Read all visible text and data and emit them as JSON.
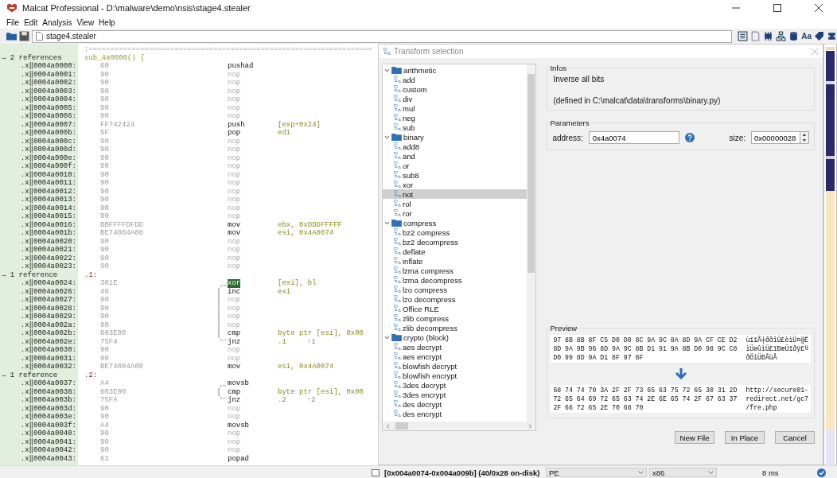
{
  "window": {
    "title": "Malcat Professional - D:\\malware\\demo\\nsis\\stage4.stealer"
  },
  "menu": [
    {
      "label": "File"
    },
    {
      "label": "Edit"
    },
    {
      "label": "Analysis"
    },
    {
      "label": "View"
    },
    {
      "label": "Help"
    }
  ],
  "toolbar": {
    "path": "stage4.stealer",
    "font_button": "Aa"
  },
  "disassembly": {
    "separator": ";==================================================================",
    "rows": [
      {
        "kind": "ref",
        "ref": "→ 2 references",
        "label": "sub_4a0000() {"
      },
      {
        "kind": "ins",
        "addr": ".x‖0004a0000:",
        "bytes": "60",
        "mnem": "pushad",
        "dim": false,
        "highlighted": false
      },
      {
        "kind": "ins",
        "addr": ".x‖0004a0001:",
        "bytes": "90",
        "mnem": "nop",
        "dim": true,
        "highlighted": false
      },
      {
        "kind": "ins",
        "addr": ".x‖0004a0002:",
        "bytes": "90",
        "mnem": "nop",
        "dim": true,
        "highlighted": false
      },
      {
        "kind": "ins",
        "addr": ".x‖0004a0003:",
        "bytes": "90",
        "mnem": "nop",
        "dim": true,
        "highlighted": false
      },
      {
        "kind": "ins",
        "addr": ".x‖0004a0004:",
        "bytes": "90",
        "mnem": "nop",
        "dim": true,
        "highlighted": false
      },
      {
        "kind": "ins",
        "addr": ".x‖0004a0005:",
        "bytes": "90",
        "mnem": "nop",
        "dim": true,
        "highlighted": false
      },
      {
        "kind": "ins",
        "addr": ".x‖0004a0006:",
        "bytes": "90",
        "mnem": "nop",
        "dim": true,
        "highlighted": false
      },
      {
        "kind": "ins",
        "addr": ".x‖0004a0007:",
        "bytes": "FF742424",
        "mnem": "push",
        "ops": "[esp+0x24]",
        "dim": false,
        "highlighted": false
      },
      {
        "kind": "ins",
        "addr": ".x‖0004a000b:",
        "bytes": "5F",
        "mnem": "pop",
        "ops": "edi",
        "dim": false,
        "highlighted": false
      },
      {
        "kind": "ins",
        "addr": ".x‖0004a000c:",
        "bytes": "90",
        "mnem": "nop",
        "dim": true,
        "highlighted": false
      },
      {
        "kind": "ins",
        "addr": ".x‖0004a000d:",
        "bytes": "90",
        "mnem": "nop",
        "dim": true,
        "highlighted": false
      },
      {
        "kind": "ins",
        "addr": ".x‖0004a000e:",
        "bytes": "90",
        "mnem": "nop",
        "dim": true,
        "highlighted": false
      },
      {
        "kind": "ins",
        "addr": ".x‖0004a000f:",
        "bytes": "90",
        "mnem": "nop",
        "dim": true,
        "highlighted": false
      },
      {
        "kind": "ins",
        "addr": ".x‖0004a0010:",
        "bytes": "90",
        "mnem": "nop",
        "dim": true,
        "highlighted": false
      },
      {
        "kind": "ins",
        "addr": ".x‖0004a0011:",
        "bytes": "90",
        "mnem": "nop",
        "dim": true,
        "highlighted": false
      },
      {
        "kind": "ins",
        "addr": ".x‖0004a0012:",
        "bytes": "90",
        "mnem": "nop",
        "dim": true,
        "highlighted": false
      },
      {
        "kind": "ins",
        "addr": ".x‖0004a0013:",
        "bytes": "90",
        "mnem": "nop",
        "dim": true,
        "highlighted": false
      },
      {
        "kind": "ins",
        "addr": ".x‖0004a0014:",
        "bytes": "90",
        "mnem": "nop",
        "dim": true,
        "highlighted": false
      },
      {
        "kind": "ins",
        "addr": ".x‖0004a0015:",
        "bytes": "90",
        "mnem": "nop",
        "dim": true,
        "highlighted": false
      },
      {
        "kind": "ins",
        "addr": ".x‖0004a0016:",
        "bytes": "BBFFFFDFDD",
        "mnem": "mov",
        "ops": "ebx, 0xDDDFFFFF",
        "dim": false,
        "highlighted": false
      },
      {
        "kind": "ins",
        "addr": ".x‖0004a001b:",
        "bytes": "BE74004A00",
        "mnem": "mov",
        "ops": "esi, 0x4A0074",
        "dim": false,
        "highlighted": false
      },
      {
        "kind": "ins",
        "addr": ".x‖0004a0020:",
        "bytes": "90",
        "mnem": "nop",
        "dim": true,
        "highlighted": false
      },
      {
        "kind": "ins",
        "addr": ".x‖0004a0021:",
        "bytes": "90",
        "mnem": "nop",
        "dim": true,
        "highlighted": false
      },
      {
        "kind": "ins",
        "addr": ".x‖0004a0022:",
        "bytes": "90",
        "mnem": "nop",
        "dim": true,
        "highlighted": false
      },
      {
        "kind": "ins",
        "addr": ".x‖0004a0023:",
        "bytes": "90",
        "mnem": "nop",
        "dim": true,
        "highlighted": false
      },
      {
        "kind": "ref",
        "ref": "→ 1 reference",
        "label": ".1:"
      },
      {
        "kind": "looptop",
        "addr": ".x‖0004a0024:",
        "bytes": "301E",
        "mnem": "xor",
        "ops": "[esi], bl",
        "dim": false,
        "highlighted": true
      },
      {
        "kind": "loopbody",
        "addr": ".x‖0004a0026:",
        "bytes": "46",
        "mnem": "inc",
        "ops": "esi",
        "dim": false,
        "highlighted": false
      },
      {
        "kind": "loopbody",
        "addr": ".x‖0004a0027:",
        "bytes": "90",
        "mnem": "nop",
        "dim": true,
        "highlighted": false
      },
      {
        "kind": "loopbody",
        "addr": ".x‖0004a0028:",
        "bytes": "90",
        "mnem": "nop",
        "dim": true,
        "highlighted": false
      },
      {
        "kind": "loopbody",
        "addr": ".x‖0004a0029:",
        "bytes": "90",
        "mnem": "nop",
        "dim": true,
        "highlighted": false
      },
      {
        "kind": "loopbody",
        "addr": ".x‖0004a002a:",
        "bytes": "90",
        "mnem": "nop",
        "dim": true,
        "highlighted": false
      },
      {
        "kind": "loopbody",
        "addr": ".x‖0004a002b:",
        "bytes": "803E00",
        "mnem": "cmp",
        "ops": "byte ptr [esi], 0x00",
        "dim": false,
        "highlighted": false
      },
      {
        "kind": "loopend",
        "addr": ".x‖0004a002e:",
        "bytes": "75F4",
        "mnem": "jnz",
        "ops": ".1",
        "xref": "↑1",
        "dim": false,
        "highlighted": false
      },
      {
        "kind": "ins",
        "addr": ".x‖0004a0030:",
        "bytes": "90",
        "mnem": "nop",
        "dim": true,
        "highlighted": false
      },
      {
        "kind": "ins",
        "addr": ".x‖0004a0031:",
        "bytes": "90",
        "mnem": "nop",
        "dim": true,
        "highlighted": false
      },
      {
        "kind": "ins",
        "addr": ".x‖0004a0032:",
        "bytes": "BE74004A00",
        "mnem": "mov",
        "ops": "esi, 0x4A0074",
        "dim": false,
        "highlighted": false
      },
      {
        "kind": "ref",
        "ref": "→ 1 reference",
        "label": ".2:"
      },
      {
        "kind": "looptop",
        "addr": ".x‖0004a0037:",
        "bytes": "A4",
        "mnem": "movsb",
        "dim": false,
        "highlighted": false
      },
      {
        "kind": "loopbody",
        "addr": ".x‖0004a0038:",
        "bytes": "803E00",
        "mnem": "cmp",
        "ops": "byte ptr [esi], 0x00",
        "dim": false,
        "highlighted": false
      },
      {
        "kind": "loopend",
        "addr": ".x‖0004a003b:",
        "bytes": "75FA",
        "mnem": "jnz",
        "ops": ".2",
        "xref": "↑2",
        "dim": false,
        "highlighted": false
      },
      {
        "kind": "ins",
        "addr": ".x‖0004a003d:",
        "bytes": "90",
        "mnem": "nop",
        "dim": true,
        "highlighted": false
      },
      {
        "kind": "ins",
        "addr": ".x‖0004a003e:",
        "bytes": "90",
        "mnem": "nop",
        "dim": true,
        "highlighted": false
      },
      {
        "kind": "ins",
        "addr": ".x‖0004a003f:",
        "bytes": "A4",
        "mnem": "movsb",
        "dim": false,
        "highlighted": false
      },
      {
        "kind": "ins",
        "addr": ".x‖0004a0040:",
        "bytes": "90",
        "mnem": "nop",
        "dim": true,
        "highlighted": false
      },
      {
        "kind": "ins",
        "addr": ".x‖0004a0041:",
        "bytes": "90",
        "mnem": "nop",
        "dim": true,
        "highlighted": false
      },
      {
        "kind": "ins",
        "addr": ".x‖0004a0042:",
        "bytes": "90",
        "mnem": "nop",
        "dim": true,
        "highlighted": false
      },
      {
        "kind": "ins",
        "addr": ".x‖0004a0043:",
        "bytes": "61",
        "mnem": "popad",
        "dim": false,
        "highlighted": false
      }
    ]
  },
  "dialog": {
    "title": "Transform selection",
    "tree": [
      {
        "label": "arithmetic",
        "expanded": true,
        "children": [
          {
            "label": "add",
            "selected": false
          },
          {
            "label": "custom",
            "selected": false
          },
          {
            "label": "div",
            "selected": false
          },
          {
            "label": "mul",
            "selected": false
          },
          {
            "label": "neg",
            "selected": false
          },
          {
            "label": "sub",
            "selected": false
          }
        ]
      },
      {
        "label": "binary",
        "expanded": true,
        "children": [
          {
            "label": "add8",
            "selected": false
          },
          {
            "label": "and",
            "selected": false
          },
          {
            "label": "or",
            "selected": false
          },
          {
            "label": "sub8",
            "selected": false
          },
          {
            "label": "xor",
            "selected": false
          },
          {
            "label": "not",
            "selected": true
          },
          {
            "label": "rol",
            "selected": false
          },
          {
            "label": "ror",
            "selected": false
          }
        ]
      },
      {
        "label": "compress",
        "expanded": true,
        "children": [
          {
            "label": "bz2 compress",
            "selected": false
          },
          {
            "label": "bz2 decompress",
            "selected": false
          },
          {
            "label": "deflate",
            "selected": false
          },
          {
            "label": "inflate",
            "selected": false
          },
          {
            "label": "lzma compress",
            "selected": false
          },
          {
            "label": "lzma decompress",
            "selected": false
          },
          {
            "label": "lzo compress",
            "selected": false
          },
          {
            "label": "lzo decompress",
            "selected": false
          },
          {
            "label": "Office RLE",
            "selected": false
          },
          {
            "label": "zlib compress",
            "selected": false
          },
          {
            "label": "zlib decompress",
            "selected": false
          }
        ]
      },
      {
        "label": "crypto (block)",
        "expanded": true,
        "children": [
          {
            "label": "aes decrypt",
            "selected": false
          },
          {
            "label": "aes encrypt",
            "selected": false
          },
          {
            "label": "blowfish decrypt",
            "selected": false
          },
          {
            "label": "blowfish encrypt",
            "selected": false
          },
          {
            "label": "3des decrypt",
            "selected": false
          },
          {
            "label": "3des encrypt",
            "selected": false
          },
          {
            "label": "des decrypt",
            "selected": false
          },
          {
            "label": "des encrypt",
            "selected": false
          }
        ]
      }
    ],
    "infos": {
      "title": "Infos",
      "description": "Inverse all bits",
      "source": "(defined in C:\\malcat\\data\\transforms\\binary.py)"
    },
    "parameters": {
      "title": "Parameters",
      "address_label": "address:",
      "address": "0x4a0074",
      "size_label": "size:",
      "size": "0x00000028"
    },
    "preview": {
      "title": "Preview",
      "input_hex": [
        "97 8B 8B 8F C5 D0 D0 8C 9A 9C 8A 8D 9A CF CE D2",
        "8D 9A 9B 96 8D 9A 9C 8B D1 91 9A 8B D0 98 9C C8",
        "D0 99 8D 9A D1 8F 97 8F"
      ],
      "input_text": [
        "ùïïÅ┼ððîÜ£èìÜ¤╬Ê",
        "ìÜøûìÜ£ïÐæÜïðÿ£╚",
        "ðÖìÜÐÅùÅ"
      ],
      "output_hex": [
        "68 74 74 70 3A 2F 2F 73 65 63 75 72 65 30 31 2D",
        "72 65 64 69 72 65 63 74 2E 6E 65 74 2F 67 63 37",
        "2F 66 72 65 2E 70 68 70"
      ],
      "output_text": [
        "http://secure01-",
        "redirect.net/gc7",
        "/fre.php"
      ]
    },
    "buttons": [
      "New File",
      "In Place",
      "Cancel"
    ]
  },
  "status_bar": {
    "selection": "[0x004a0074-0x004a009b] (40/0x28 on-disk)",
    "format": "PE",
    "architecture": "x86",
    "time": "8 ms"
  }
}
